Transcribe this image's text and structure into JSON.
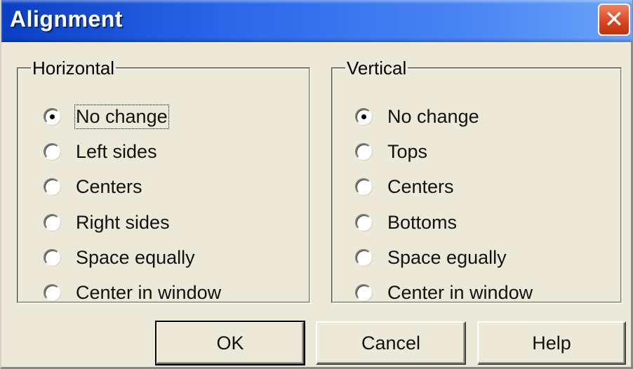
{
  "window": {
    "title": "Alignment",
    "close_symbol": "✕"
  },
  "horizontal": {
    "legend": "Horizontal",
    "options": [
      {
        "label": "No change",
        "checked": true
      },
      {
        "label": "Left sides",
        "checked": false
      },
      {
        "label": "Centers",
        "checked": false
      },
      {
        "label": "Right sides",
        "checked": false
      },
      {
        "label": "Space equally",
        "checked": false
      },
      {
        "label": "Center in window",
        "checked": false
      }
    ]
  },
  "vertical": {
    "legend": "Vertical",
    "options": [
      {
        "label": "No change",
        "checked": true
      },
      {
        "label": "Tops",
        "checked": false
      },
      {
        "label": "Centers",
        "checked": false
      },
      {
        "label": "Bottoms",
        "checked": false
      },
      {
        "label": "Space egually",
        "checked": false
      },
      {
        "label": "Center in window",
        "checked": false
      }
    ]
  },
  "buttons": {
    "ok": "OK",
    "cancel": "Cancel",
    "help": "Help"
  },
  "colors": {
    "titlebar": "#2a66e8",
    "close": "#d8441e",
    "face": "#ece9d8"
  }
}
